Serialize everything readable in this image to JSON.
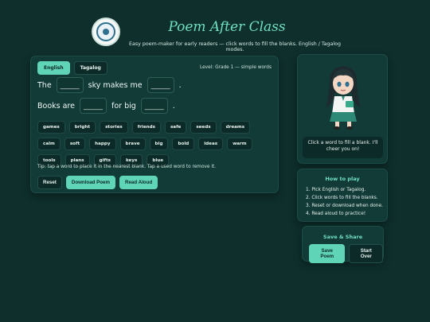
{
  "header": {
    "title": "Poem After Class",
    "subtitle": "Easy poem-maker for early readers — click words to fill the blanks. English / Tagalog modes."
  },
  "tabs": [
    {
      "label": "English",
      "active": true
    },
    {
      "label": "Tagalog",
      "active": false
    }
  ],
  "level": "Level: Grade 1 — simple words",
  "poem": {
    "line1": {
      "before": "The",
      "blank1": "______",
      "middle": "sky makes me",
      "blank2": "______",
      "end": "."
    },
    "line2": {
      "before": "Books are",
      "blank1": "______",
      "middle": "for big",
      "blank2": "______",
      "end": "."
    }
  },
  "words": [
    "games",
    "bright",
    "stories",
    "friends",
    "safe",
    "seeds",
    "dreams",
    "calm",
    "soft",
    "happy",
    "brave",
    "big",
    "bold",
    "ideas",
    "warm",
    "tools",
    "plans",
    "gifts",
    "keys",
    "blue"
  ],
  "tip": "Tip: tap a word to place it in the nearest blank. Tap a used word to remove it.",
  "actions": {
    "reset": "Reset",
    "download": "Download Poem",
    "read": "Read Aloud"
  },
  "mascot": {
    "message": "Click a word to fill a blank. I'll cheer you on!"
  },
  "howto": {
    "title": "How to play",
    "steps": [
      "1. Pick English or Tagalog.",
      "2. Click words to fill the blanks.",
      "3. Reset or download when done.",
      "4. Read aloud to practice!"
    ]
  },
  "share": {
    "title": "Save & Share",
    "save": "Save Poem",
    "start_over": "Start Over"
  },
  "colors": {
    "accent": "#5fd4b6",
    "background": "#0e2f2c",
    "panel": "#123b37"
  }
}
